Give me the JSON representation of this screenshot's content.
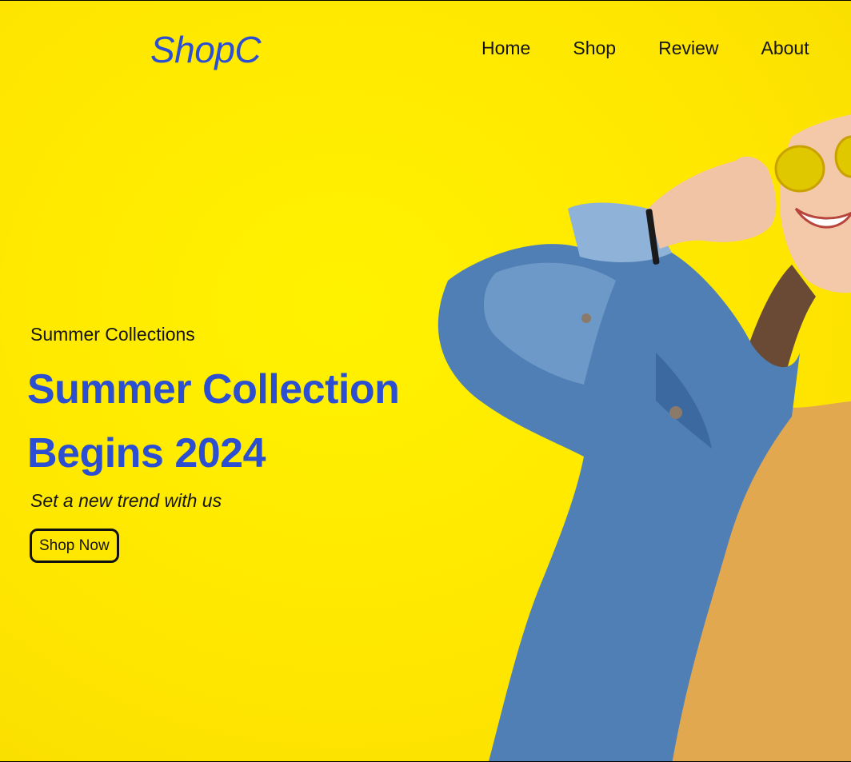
{
  "brand": {
    "logo": "ShopC"
  },
  "nav": {
    "items": [
      {
        "label": "Home"
      },
      {
        "label": "Shop"
      },
      {
        "label": "Review"
      },
      {
        "label": "About"
      }
    ]
  },
  "hero": {
    "eyebrow": "Summer Collections",
    "headline_line1": "Summer Collection",
    "headline_line2": "Begins 2024",
    "tagline": "Set a new trend with us",
    "cta_label": "Shop Now",
    "image_desc": "woman-in-denim-jacket-with-sunglasses"
  },
  "colors": {
    "background": "#ffeb00",
    "brand_blue": "#2c4fd1",
    "text": "#141414",
    "denim": "#4f7fb5",
    "shirt": "#e2a850"
  }
}
